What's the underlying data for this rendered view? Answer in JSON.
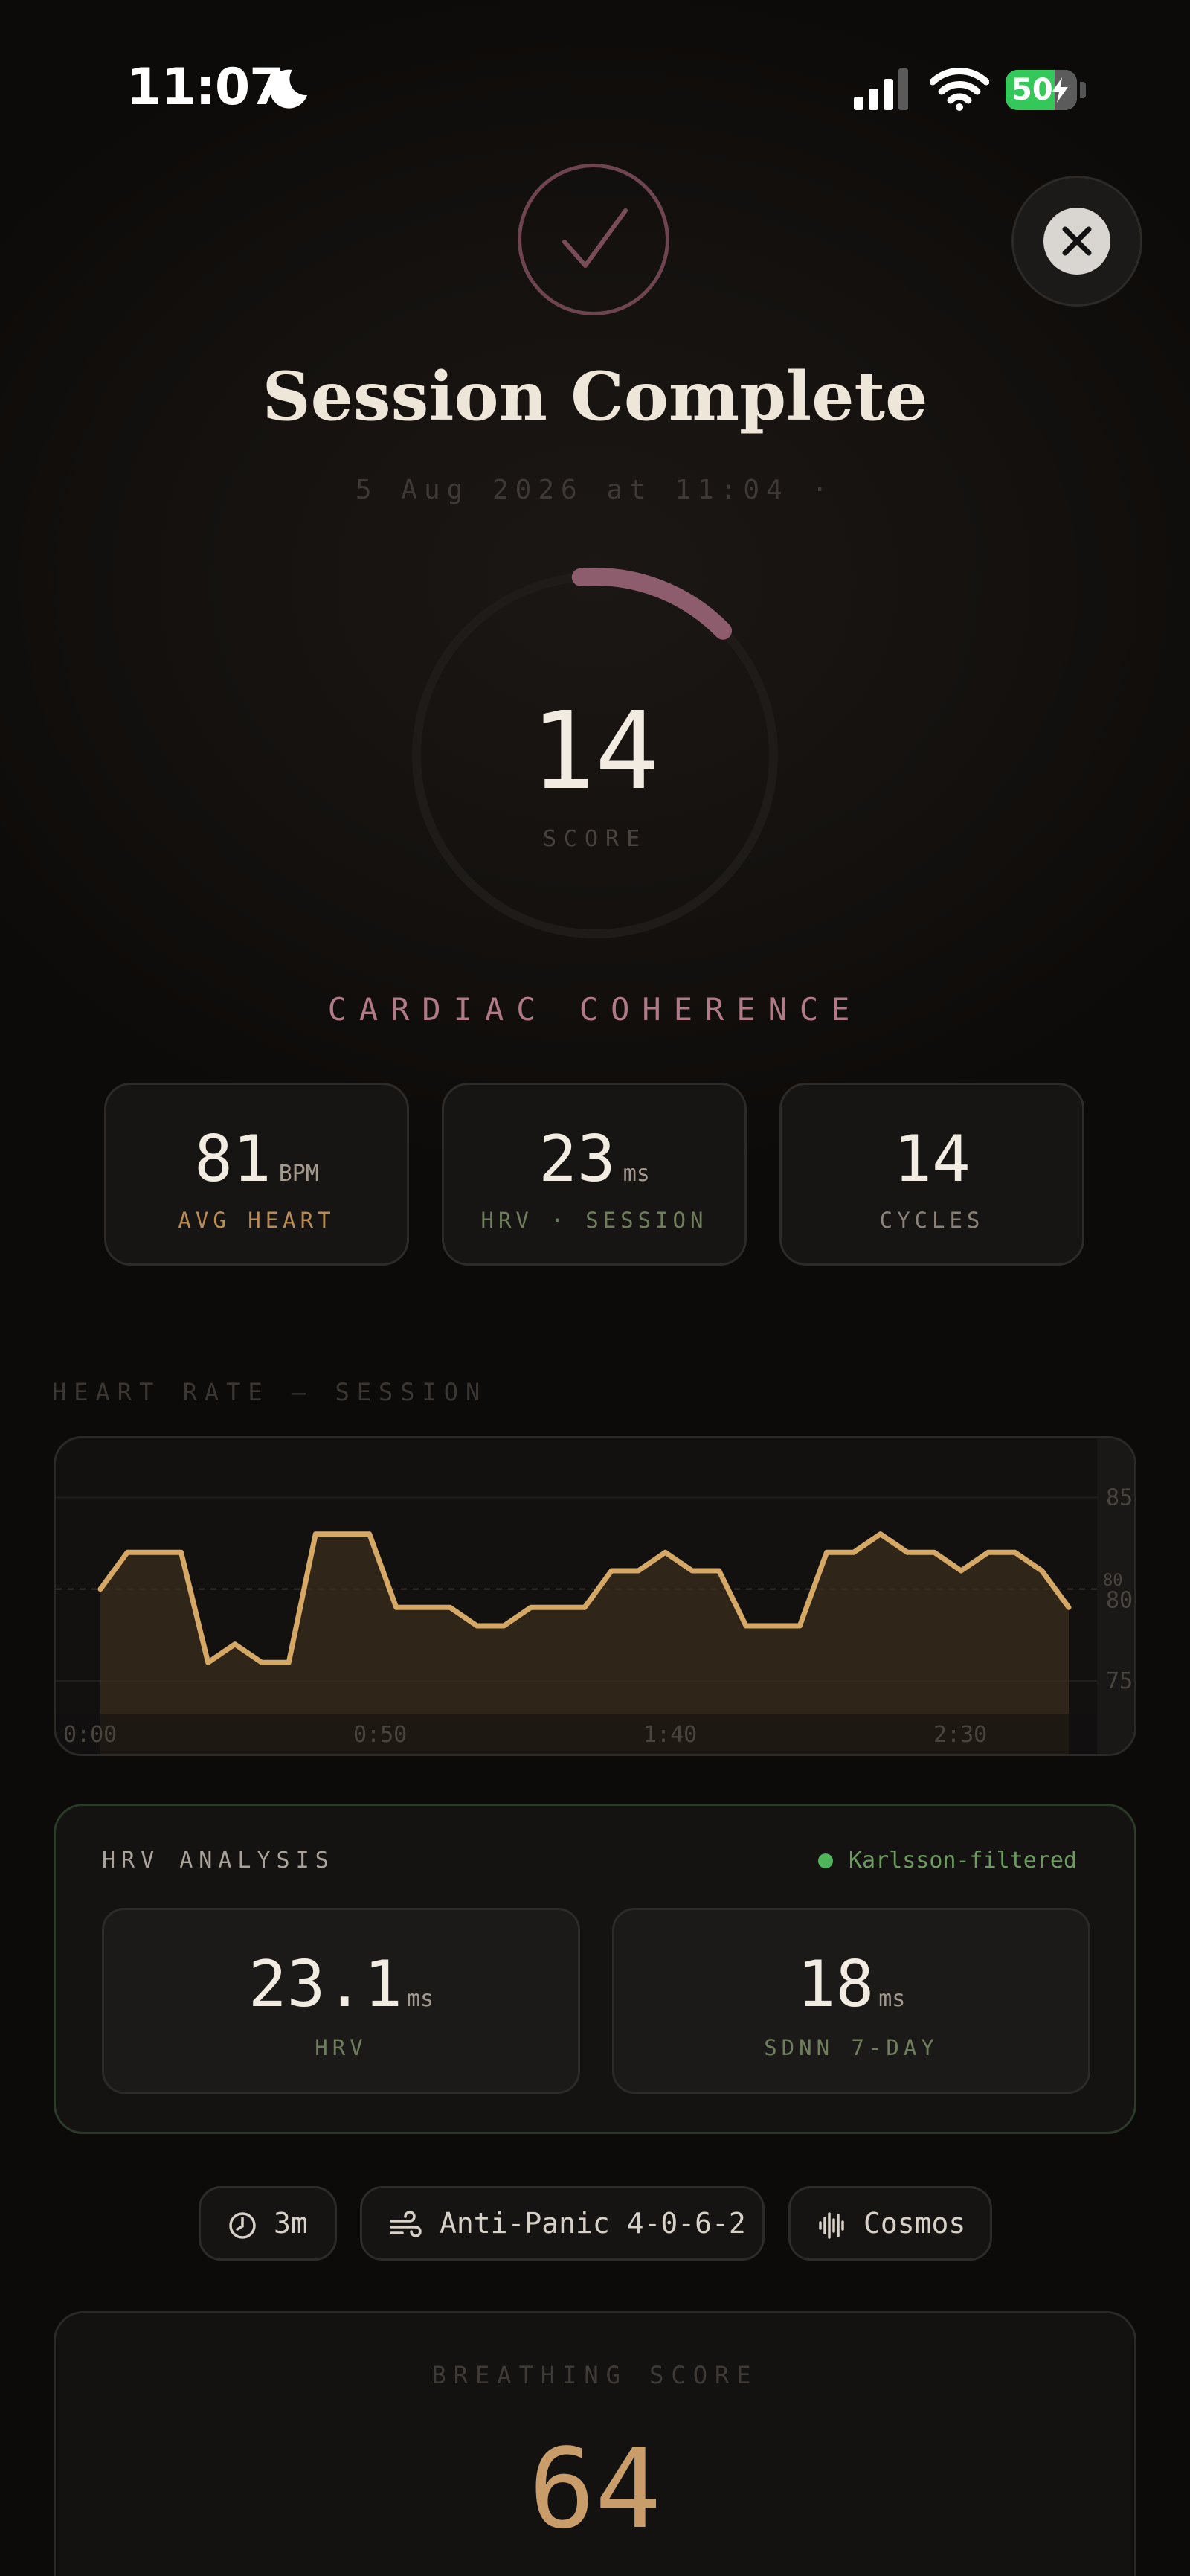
{
  "status_bar": {
    "time": "11:07",
    "battery": "50"
  },
  "header": {
    "title": "Session Complete",
    "subtitle": "5 Aug 2026 at 11:04 ·"
  },
  "score": {
    "value": "14",
    "label": "SCORE",
    "progress": 0.14,
    "mode": "CARDIAC COHERENCE"
  },
  "stats": [
    {
      "value": "81",
      "unit": "BPM",
      "label": "AVG HEART",
      "label_color": "#b88c52"
    },
    {
      "value": "23",
      "unit": "ms",
      "label": "HRV · SESSION",
      "label_color": "#6e7d5c"
    },
    {
      "value": "14",
      "unit": "",
      "label": "CYCLES",
      "label_color": "#8a8279"
    }
  ],
  "heart_rate_section": {
    "label": "HEART RATE — SESSION"
  },
  "chart_data": {
    "type": "area",
    "x_tick_labels": [
      "0:00",
      "0:50",
      "1:40",
      "2:30"
    ],
    "y_tick_labels": [
      "85",
      "80",
      "80",
      "75"
    ],
    "ylim": [
      72,
      87
    ],
    "reference_line": 80,
    "color": "#d6a866",
    "values": [
      80,
      82,
      82,
      82,
      76,
      77,
      76,
      76,
      83,
      83,
      83,
      79,
      79,
      79,
      78,
      78,
      79,
      79,
      79,
      81,
      81,
      82,
      81,
      81,
      78,
      78,
      78,
      82,
      82,
      83,
      82,
      82,
      81,
      82,
      82,
      81,
      79
    ]
  },
  "hrv_analysis": {
    "title": "HRV ANALYSIS",
    "filter_label": "Karlsson-filtered",
    "filter_color": "#4fb55a",
    "metrics": [
      {
        "value": "23.1",
        "unit": "ms",
        "label": "HRV"
      },
      {
        "value": "18",
        "unit": "ms",
        "label": "SDNN 7-DAY"
      }
    ]
  },
  "chips": [
    {
      "icon": "clock-icon",
      "label": "3m"
    },
    {
      "icon": "wind-icon",
      "label": "Anti-Panic 4-0-6-2"
    },
    {
      "icon": "waveform-icon",
      "label": "Cosmos"
    }
  ],
  "breathing": {
    "label": "BREATHING SCORE",
    "value": "64"
  }
}
